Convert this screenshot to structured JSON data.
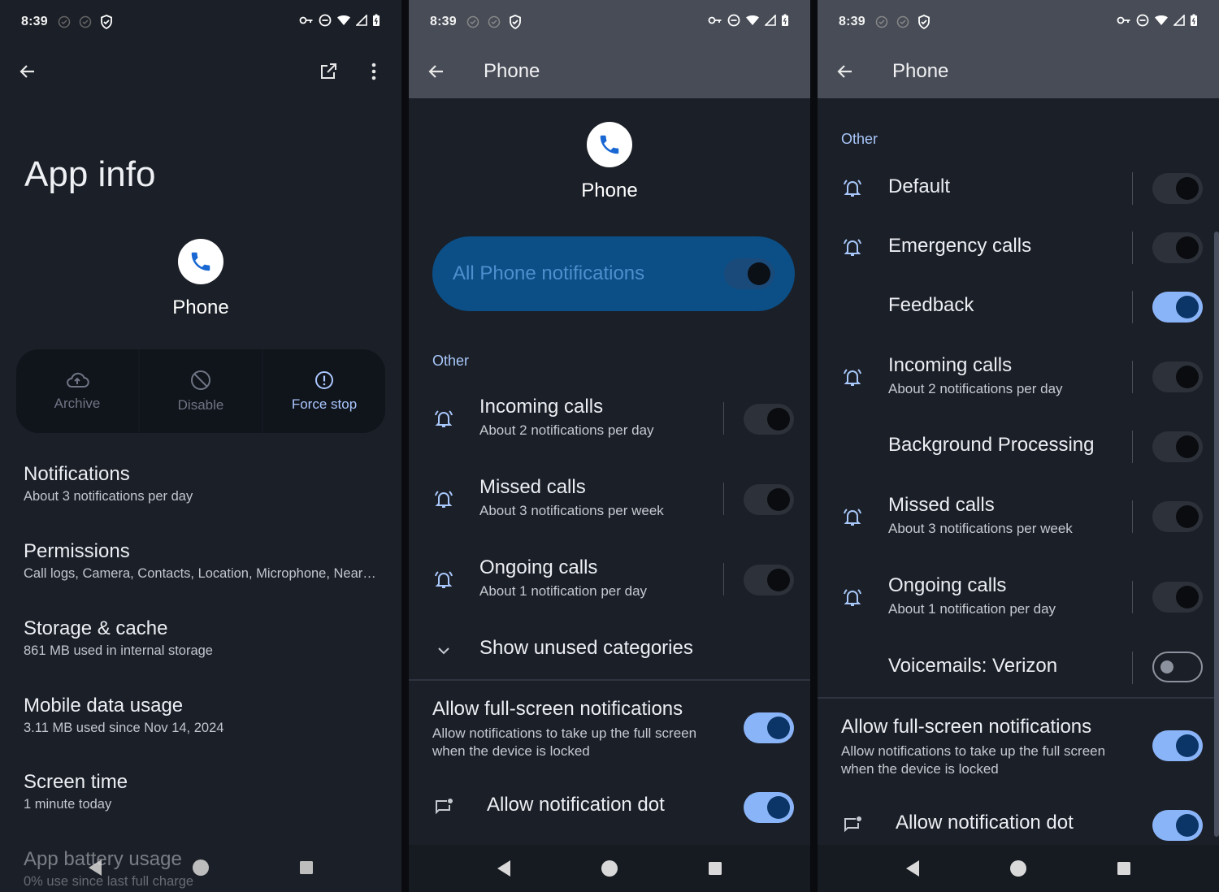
{
  "status": {
    "time": "8:39"
  },
  "panel1": {
    "big_title": "App info",
    "app_name": "Phone",
    "actions": [
      {
        "label": "Archive",
        "icon": "cloud-upload-icon",
        "enabled": false
      },
      {
        "label": "Disable",
        "icon": "disable-icon",
        "enabled": false
      },
      {
        "label": "Force stop",
        "icon": "alert-circle-icon",
        "enabled": true
      }
    ],
    "items": [
      {
        "title": "Notifications",
        "subtitle": "About 3 notifications per day"
      },
      {
        "title": "Permissions",
        "subtitle": "Call logs, Camera, Contacts, Location, Microphone, Near…"
      },
      {
        "title": "Storage & cache",
        "subtitle": "861 MB used in internal storage"
      },
      {
        "title": "Mobile data usage",
        "subtitle": "3.11 MB used since Nov 14, 2024"
      },
      {
        "title": "Screen time",
        "subtitle": "1 minute today"
      },
      {
        "title": "App battery usage",
        "subtitle": "0% use since last full charge"
      }
    ]
  },
  "panel2": {
    "title": "Phone",
    "app_name": "Phone",
    "master_label": "All Phone notifications",
    "master_on": true,
    "section": "Other",
    "rows": [
      {
        "title": "Incoming calls",
        "subtitle": "About 2 notifications per day",
        "on": false
      },
      {
        "title": "Missed calls",
        "subtitle": "About 3 notifications per week",
        "on": false
      },
      {
        "title": "Ongoing calls",
        "subtitle": "About 1 notification per day",
        "on": false
      }
    ],
    "show_unused": "Show unused categories",
    "fullscreen_title": "Allow full-screen notifications",
    "fullscreen_sub": "Allow notifications to take up the full screen when the device is locked",
    "fullscreen_on": true,
    "dot_label": "Allow notification dot",
    "dot_on": true
  },
  "panel3": {
    "title": "Phone",
    "section": "Other",
    "rows": [
      {
        "title": "Default",
        "subtitle": "",
        "icon": true,
        "on": false
      },
      {
        "title": "Emergency calls",
        "subtitle": "",
        "icon": true,
        "on": false
      },
      {
        "title": "Feedback",
        "subtitle": "",
        "icon": false,
        "on": true
      },
      {
        "title": "Incoming calls",
        "subtitle": "About 2 notifications per day",
        "icon": true,
        "on": false
      },
      {
        "title": "Background Processing",
        "subtitle": "",
        "icon": false,
        "on": false
      },
      {
        "title": "Missed calls",
        "subtitle": "About 3 notifications per week",
        "icon": true,
        "on": false
      },
      {
        "title": "Ongoing calls",
        "subtitle": "About 1 notification per day",
        "icon": true,
        "on": false
      },
      {
        "title": "Voicemails: Verizon",
        "subtitle": "",
        "icon": false,
        "on": false
      }
    ],
    "fullscreen_title": "Allow full-screen notifications",
    "fullscreen_sub": "Allow notifications to take up the full screen when the device is locked",
    "fullscreen_on": true,
    "dot_label": "Allow notification dot",
    "dot_on": true
  },
  "colors": {
    "accent": "#a8c7fa",
    "toggle_on": "#8ab4f8",
    "panel_bg": "#1b1f27",
    "appbar_gray": "#474c56",
    "master_bg": "#0b4f86"
  }
}
